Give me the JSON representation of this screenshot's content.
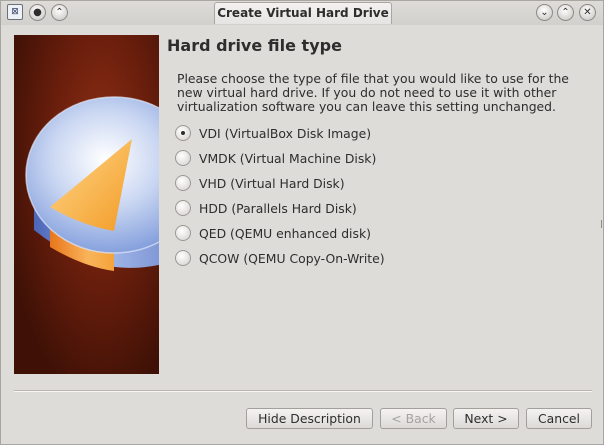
{
  "window": {
    "title": "Create Virtual Hard Drive",
    "app_icon_glyph": "⊠",
    "controls": {
      "menu_glyph": "●",
      "keep_above_glyph": "⌃",
      "minimize_glyph": "⌄",
      "maximize_glyph": "⌃",
      "close_glyph": "✕"
    }
  },
  "page": {
    "title": "Hard drive file type",
    "description": "Please choose the type of file that you would like to use for the new virtual hard drive. If you do not need to use it with other virtualization software you can leave this setting unchanged."
  },
  "options": [
    {
      "label": "VDI (VirtualBox Disk Image)",
      "checked": true
    },
    {
      "label": "VMDK (Virtual Machine Disk)",
      "checked": false
    },
    {
      "label": "VHD (Virtual Hard Disk)",
      "checked": false
    },
    {
      "label": "HDD (Parallels Hard Disk)",
      "checked": false
    },
    {
      "label": "QED (QEMU enhanced disk)",
      "checked": false
    },
    {
      "label": "QCOW (QEMU Copy-On-Write)",
      "checked": false
    }
  ],
  "buttons": {
    "hide_description": "Hide Description",
    "back": "< Back",
    "next": "Next >",
    "cancel": "Cancel"
  },
  "colors": {
    "window_bg": "#dedcd9",
    "text": "#2d2d2d",
    "image_bg": "#6a1e0c",
    "disk_blue": "#7f9bd8",
    "disk_orange": "#f4a43a"
  }
}
